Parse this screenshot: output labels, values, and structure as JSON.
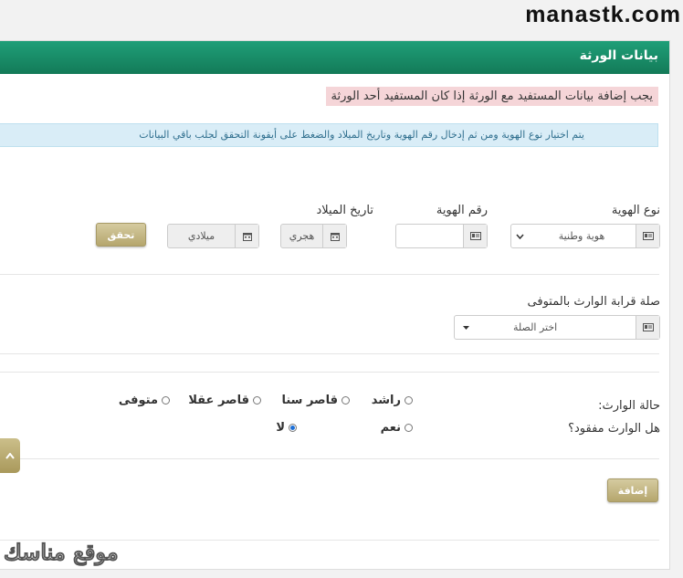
{
  "site_watermark": "manastk.com",
  "bottom_watermark": "موقع مناسك",
  "panel": {
    "title": "بيانات الورثة",
    "warning": "يجب إضافة بيانات المستفيد مع الورثة إذا كان المستفيد أحد الورثة",
    "info": "يتم اختيار نوع الهوية ومن ثم إدخال رقم الهوية وتاريخ الميلاد والضغط على أيقونة التحقق لجلب باقي البيانات"
  },
  "identity": {
    "type_label": "نوع الهوية",
    "type_value": "هوية وطنية",
    "number_label": "رقم الهوية",
    "number_value": "",
    "birth_label": "تاريخ الميلاد",
    "hijri_placeholder": "هجري",
    "gregorian_placeholder": "ميلادي",
    "verify_button": "تحقق"
  },
  "relation": {
    "label": "صلة قرابة الوارث بالمتوفى",
    "value": "اختر الصلة"
  },
  "heir_status": {
    "label": "حالة الوارث:",
    "options": [
      "راشد",
      "قاصر سنا",
      "قاصر عقلا",
      "متوفى"
    ]
  },
  "missing": {
    "label": "هل الوارث مفقود؟",
    "options": [
      "نعم",
      "لا"
    ],
    "selected": "لا"
  },
  "add_button": "إضافة",
  "icons": {
    "id_card": "id-card-icon",
    "calendar": "calendar-icon",
    "chevron": "chevron-down-icon",
    "scroll_up": "chevron-up-icon"
  }
}
